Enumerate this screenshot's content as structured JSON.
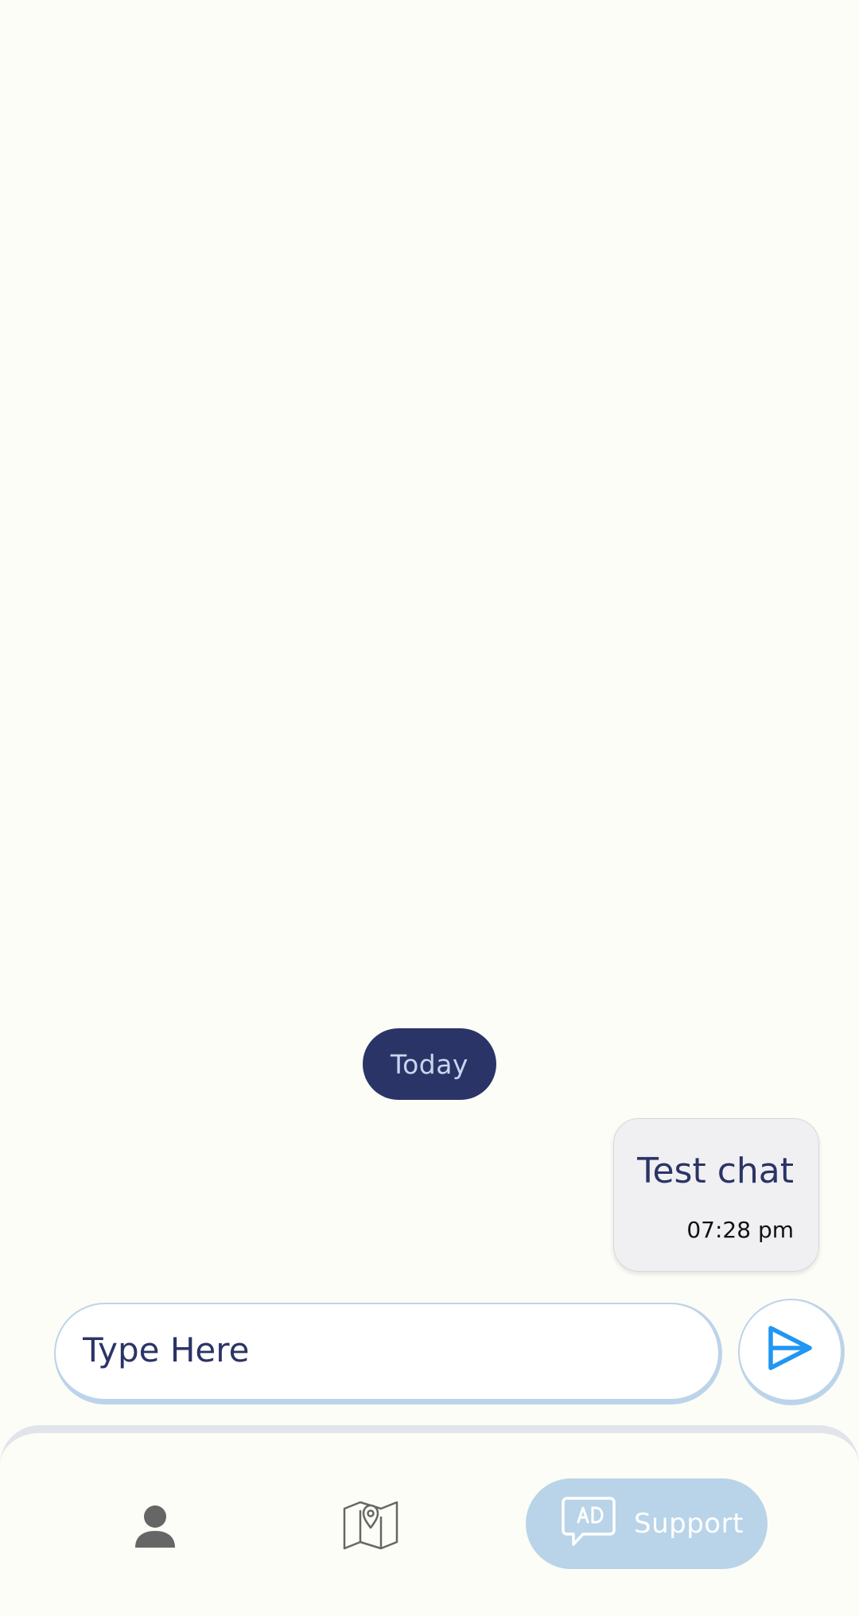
{
  "chat": {
    "date_separator": "Today",
    "messages": [
      {
        "text": "Test chat",
        "time": "07:28 pm",
        "direction": "outgoing"
      }
    ]
  },
  "composer": {
    "placeholder": "Type Here",
    "value": ""
  },
  "bottom_nav": {
    "items": [
      {
        "icon": "person-icon",
        "label": "",
        "active": false
      },
      {
        "icon": "map-pin-icon",
        "label": "",
        "active": false
      },
      {
        "icon": "support-chat-icon",
        "label": "Support",
        "active": true
      }
    ]
  },
  "colors": {
    "background": "#fcfdf6",
    "primary_navy": "#2b3467",
    "accent_light_blue": "#b9d4e8",
    "send_blue": "#2196f3",
    "icon_gray": "#666666"
  }
}
